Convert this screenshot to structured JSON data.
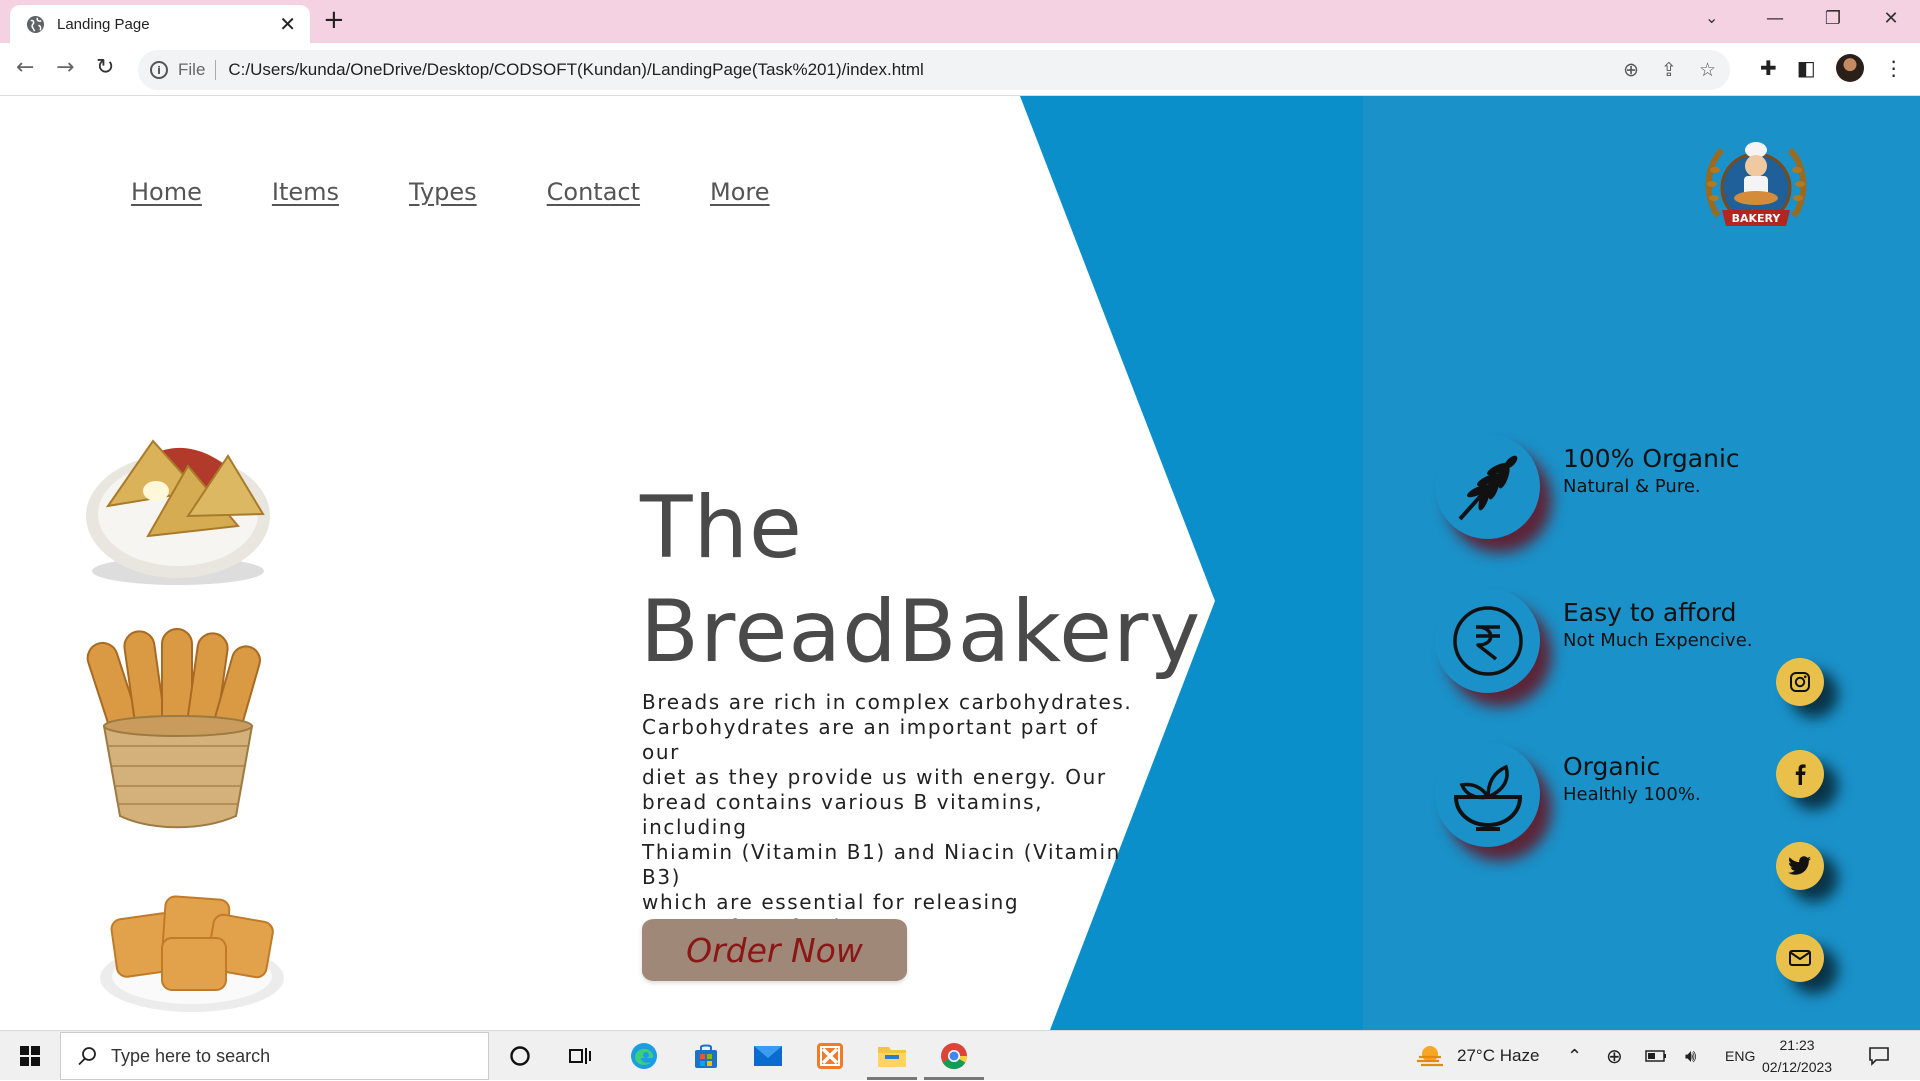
{
  "browser": {
    "tab_title": "Landing Page",
    "file_label": "File",
    "url": "C:/Users/kunda/OneDrive/Desktop/CODSOFT(Kundan)/LandingPage(Task%201)/index.html"
  },
  "nav": {
    "items": [
      "Home",
      "Items",
      "Types",
      "Contact",
      "More"
    ]
  },
  "logo": {
    "text": "BAKERY"
  },
  "hero": {
    "title_line1": "The",
    "title_line2": "BreadBakery",
    "description": "Breads are rich in complex carbohydrates.\nCarbohydrates are an important part of our\ndiet as they provide us with energy. Our\nbread contains various B vitamins, including\nThiamin (Vitamin B1) and Niacin (Vitamin B3)\nwhich are essential for releasing\nenergy from food.",
    "order_button": "Order Now"
  },
  "features": [
    {
      "title": "100% Organic",
      "subtitle": "Natural & Pure.",
      "icon": "wheat-icon"
    },
    {
      "title": "Easy to afford",
      "subtitle": "Not Much Expencive.",
      "icon": "rupee-icon"
    },
    {
      "title": "Organic",
      "subtitle": "Healthly 100%.",
      "icon": "salad-bowl-icon"
    }
  ],
  "social": [
    "instagram-icon",
    "facebook-icon",
    "twitter-icon",
    "mail-icon"
  ],
  "colors": {
    "accent_blue": "#1a91c9",
    "button_bg": "#a08878",
    "button_text": "#8b1616",
    "social_yellow": "#e9c04a",
    "tab_strip": "#f5d2e2"
  },
  "taskbar": {
    "search_placeholder": "Type here to search",
    "weather": "27°C  Haze",
    "language": "ENG",
    "time": "21:23",
    "date": "02/12/2023"
  }
}
